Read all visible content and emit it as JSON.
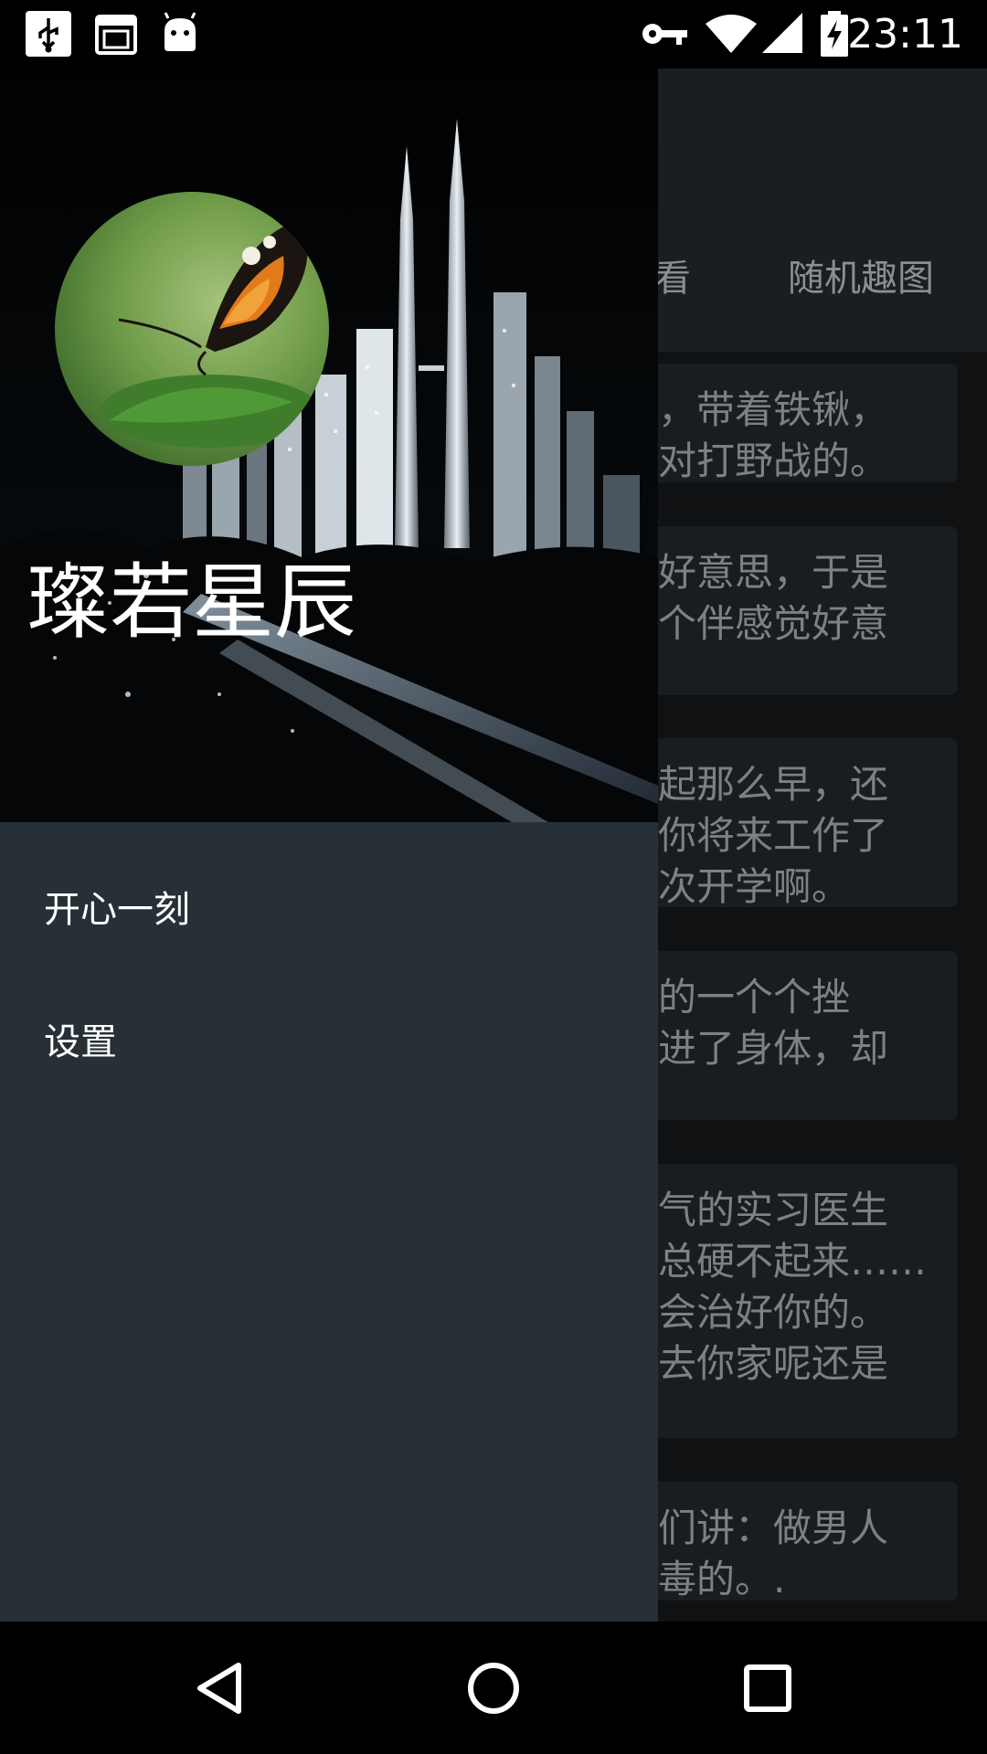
{
  "status_bar": {
    "time": "23:11",
    "left_icons": [
      "usb-icon",
      "calendar-icon",
      "android-icon"
    ],
    "right_icons": [
      "vpn-key-icon",
      "wifi-icon",
      "cell-signal-icon",
      "battery-charging-icon"
    ]
  },
  "background_app": {
    "tabs": [
      {
        "label": "看"
      },
      {
        "label": "随机趣图"
      }
    ],
    "cards": [
      {
        "lines": [
          "，带着铁锹，",
          "对打野战的。"
        ]
      },
      {
        "lines": [
          "好意思，于是",
          "个伴感觉好意"
        ]
      },
      {
        "lines": [
          "起那么早，还",
          "你将来工作了",
          "次开学啊。"
        ]
      },
      {
        "lines": [
          "的一个个挫",
          "进了身体，却"
        ]
      },
      {
        "lines": [
          "气的实习医生",
          "总硬不起来……",
          "会治好你的。",
          "去你家呢还是"
        ]
      },
      {
        "lines": [
          "们讲：做男人",
          "毒的。."
        ]
      }
    ]
  },
  "drawer": {
    "title": "璨若星辰",
    "avatar_icon": "butterfly-avatar",
    "header_image": "city-skyline-night",
    "menu": [
      {
        "label": "开心一刻"
      },
      {
        "label": "设置"
      }
    ]
  },
  "nav_bar": {
    "buttons": [
      "back-icon",
      "home-icon",
      "recents-icon"
    ]
  },
  "colors": {
    "drawer_bg": "#263036",
    "header_bg": "#000000",
    "card_bg": "#1a1d1f",
    "card_text": "#7d8184"
  }
}
